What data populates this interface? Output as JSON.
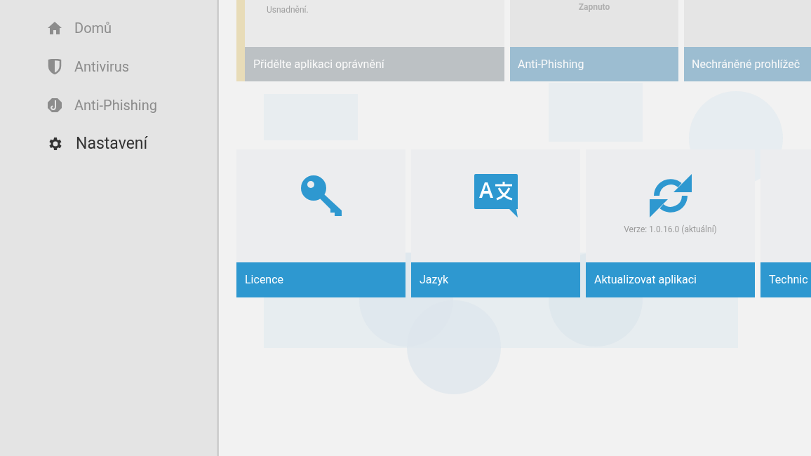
{
  "sidebar": {
    "items": [
      {
        "kind": "home",
        "label": "Domů",
        "selected": false
      },
      {
        "kind": "shield",
        "label": "Antivirus",
        "selected": false
      },
      {
        "kind": "hook",
        "label": "Anti-Phishing",
        "selected": false
      },
      {
        "kind": "gear",
        "label": "Nastavení",
        "selected": true
      }
    ]
  },
  "top_cards": [
    {
      "kind": "warning",
      "text": "Usnadnění.",
      "title": "Přidělte aplikaci oprávnění"
    },
    {
      "kind": "feature",
      "status": "Zapnuto",
      "title": "Anti-Phishing"
    },
    {
      "kind": "feature",
      "title": "Nechráněné prohlížeč"
    }
  ],
  "settings_cards": [
    {
      "kind": "key",
      "title": "Licence"
    },
    {
      "kind": "language",
      "title": "Jazyk"
    },
    {
      "kind": "update",
      "note": "Verze: 1.0.16.0 (aktuální)",
      "title": "Aktualizovat aplikaci"
    },
    {
      "kind": "info",
      "title": "Technic"
    }
  ]
}
